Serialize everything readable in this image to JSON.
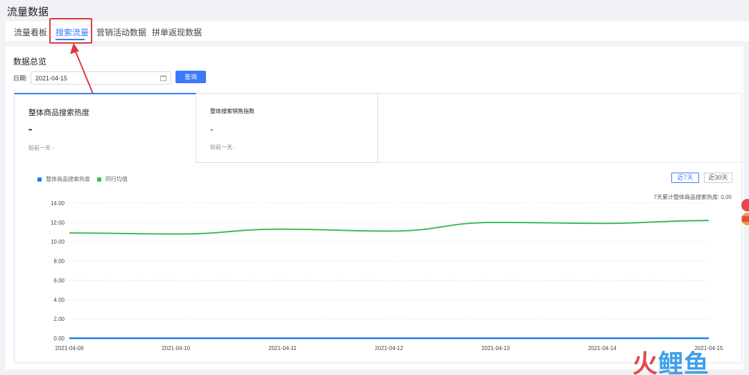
{
  "page": {
    "title": "流量数据"
  },
  "tabs": [
    {
      "label": "流量看板",
      "active": false
    },
    {
      "label": "搜索流量",
      "active": true
    },
    {
      "label": "营销活动数据",
      "active": false
    },
    {
      "label": "拼单返现数据",
      "active": false
    }
  ],
  "overview": {
    "title": "数据总览",
    "date_label": "日期:",
    "date_value": "2021-04-15",
    "query_button": "查询"
  },
  "cards": [
    {
      "title": "整体商品搜索热度",
      "value": "-",
      "compare": "较前一天  -"
    },
    {
      "title": "整体搜索销售指数",
      "value": "-",
      "compare": "较前一天  -"
    }
  ],
  "chart": {
    "legend": [
      "整体商品搜索热度",
      "同行均值"
    ],
    "range_buttons": [
      {
        "label": "近7天",
        "active": true
      },
      {
        "label": "近30天",
        "active": false
      }
    ],
    "cumulative_text": "7天累计整体商品搜索热度: 0.00"
  },
  "chart_data": {
    "type": "line",
    "x": [
      "2021-04-09",
      "2021-04-10",
      "2021-04-11",
      "2021-04-12",
      "2021-04-13",
      "2021-04-14",
      "2021-04-15"
    ],
    "yticks": [
      "0.00",
      "2.00",
      "4.00",
      "6.00",
      "8.00",
      "10.00",
      "12.00",
      "14.00"
    ],
    "ylim": [
      0,
      14
    ],
    "series": [
      {
        "name": "整体商品搜索热度",
        "color": "#1f7ee8",
        "values": [
          0,
          0,
          0,
          0,
          0,
          0,
          0
        ]
      },
      {
        "name": "同行均值",
        "color": "#3cba54",
        "values": [
          10.9,
          10.8,
          11.3,
          11.1,
          12.0,
          11.9,
          12.2
        ]
      }
    ]
  },
  "colors": {
    "accent": "#3a7bfc",
    "highlight": "#e0393e",
    "green": "#3cba54",
    "blue": "#1f7ee8"
  },
  "watermark": {
    "part1": "火",
    "part2": "鲤鱼"
  }
}
